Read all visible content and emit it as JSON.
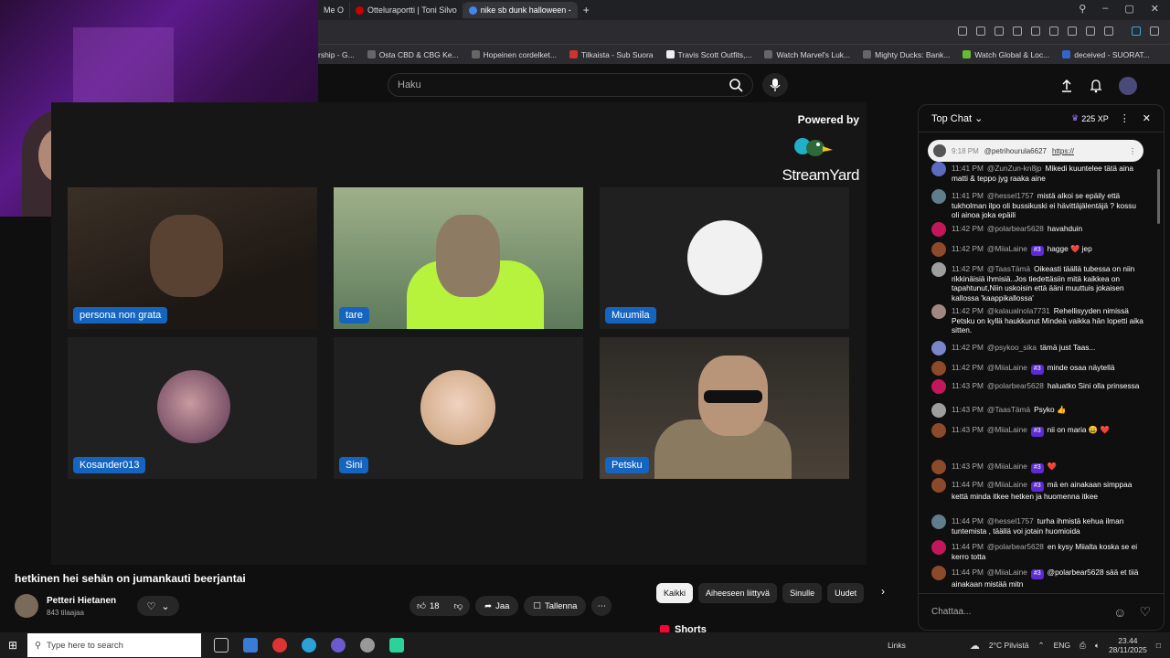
{
  "browser": {
    "tabs": [
      {
        "label": "Me O",
        "active": false
      },
      {
        "label": "Otteluraportti | Toni Silvo",
        "active": false
      },
      {
        "label": "nike sb dunk halloween -",
        "active": true
      }
    ],
    "new_tab_glyph": "+",
    "bookmarks": [
      "rship - G...",
      "Osta CBD & CBG Ke...",
      "Hopeinen cordelket...",
      "Tilkaista - Sub Suora",
      "Travis Scott Outfits,...",
      "Watch Marvel's Luk...",
      "Mighty Ducks: Bank...",
      "Watch Global & Loc...",
      "deceived - SUORAT..."
    ]
  },
  "youtube": {
    "search_placeholder": "Haku",
    "video_title": "hetkinen hei sehän on jumankauti beerjantai",
    "channel": {
      "name": "Petteri Hietanen",
      "subscribers": "843 tilaajaa"
    },
    "actions": {
      "likes": "18",
      "share": "Jaa",
      "save": "Tallenna"
    },
    "chips": [
      "Kaikki",
      "Aiheeseen liittyvä",
      "Sinulle",
      "Uudet"
    ],
    "shorts_label": "Shorts"
  },
  "streamyard": {
    "powered_by": "Powered by",
    "brand": "StreamYard",
    "participants": [
      {
        "name": "persona non grata"
      },
      {
        "name": "tare"
      },
      {
        "name": "Muumila"
      },
      {
        "name": "Kosander013"
      },
      {
        "name": "Sini"
      },
      {
        "name": "Petsku"
      }
    ]
  },
  "chat": {
    "mode": "Top Chat",
    "xp": "225 XP",
    "pinned": {
      "time": "9:18 PM",
      "user": "@petrihourula6627",
      "text": "https://"
    },
    "input_placeholder": "Chattaa...",
    "messages": [
      {
        "time": "11:41 PM",
        "user": "@ZunZun-kn8jp",
        "text": "Mikedi kuuntelee tätä aina matti & teppo jyg raaka aine",
        "badge": "",
        "color": "#5c6bc0"
      },
      {
        "time": "11:41 PM",
        "user": "@hessel1757",
        "text": "mistä alkoi se epäily että tukholman ilpo oli bussikuski ei hävittäjälentäjä ? kossu oli ainoa joka epäili",
        "badge": "",
        "color": "#607d8b"
      },
      {
        "time": "11:42 PM",
        "user": "@polarbear5628",
        "text": "havahduin",
        "badge": "",
        "color": "#c2185b"
      },
      {
        "time": "11:42 PM",
        "user": "@MiiaLaine",
        "text": "hagge ❤️ jep",
        "badge": "#3",
        "color": "#8d4a2b"
      },
      {
        "time": "11:42 PM",
        "user": "@TaasTämä",
        "text": "Oikeasti täällä tubessa on niin rikkinäisiä ihmisiä..Jos tiedettäsiin mitä kaikkea on tapahtunut,Niin uskoisin että ääni muuttuis jokaisen kallossa 'kaappikallossa'",
        "badge": "",
        "color": "#9e9e9e"
      },
      {
        "time": "11:42 PM",
        "user": "@kalaualnola7731",
        "text": "Rehellisyyden nimissä Petsku on kyllä haukkunut Mindeä vaikka hän lopetti aika sitten.",
        "badge": "",
        "color": "#a1887f"
      },
      {
        "time": "11:42 PM",
        "user": "@psykoo_sika",
        "text": "tämä just Taas...",
        "badge": "",
        "color": "#7986cb"
      },
      {
        "time": "11:42 PM",
        "user": "@MiiaLaine",
        "text": "minde osaa näytellä",
        "badge": "#3",
        "color": "#8d4a2b"
      },
      {
        "time": "11:43 PM",
        "user": "@polarbear5628",
        "text": "haluatko Sini olla prinsessa",
        "badge": "",
        "color": "#c2185b"
      },
      {
        "time": "11:43 PM",
        "user": "@TaasTämä",
        "text": "Psyko 👍",
        "badge": "",
        "color": "#9e9e9e"
      },
      {
        "time": "11:43 PM",
        "user": "@MiiaLaine",
        "text": "nii on maria 😀 ❤️",
        "badge": "#3",
        "color": "#8d4a2b"
      },
      {
        "time": "11:43 PM",
        "user": "@MiiaLaine",
        "text": "❤️",
        "badge": "#3",
        "color": "#8d4a2b"
      },
      {
        "time": "11:44 PM",
        "user": "@MiiaLaine",
        "text": "mä en ainakaan simppaa kettä minda itkee hetken ja huomenna itkee",
        "badge": "#3",
        "color": "#8d4a2b"
      },
      {
        "time": "11:44 PM",
        "user": "@hessel1757",
        "text": "turha ihmistä kehua ilman tuntemista , täällä voi jotain huomioida",
        "badge": "",
        "color": "#607d8b"
      },
      {
        "time": "11:44 PM",
        "user": "@polarbear5628",
        "text": "en kysy Miialta koska se ei kerro totta",
        "badge": "",
        "color": "#c2185b"
      },
      {
        "time": "11:44 PM",
        "user": "@MiiaLaine",
        "text": "@polarbear5628 sää et tiiä ainakaan mistää mitn",
        "badge": "#3",
        "color": "#8d4a2b"
      }
    ]
  },
  "taskbar": {
    "search_placeholder": "Type here to search",
    "links": "Links",
    "weather": "2°C Pilvistä",
    "lang": "ENG",
    "time": "23.44",
    "date": "28/11/2025"
  }
}
